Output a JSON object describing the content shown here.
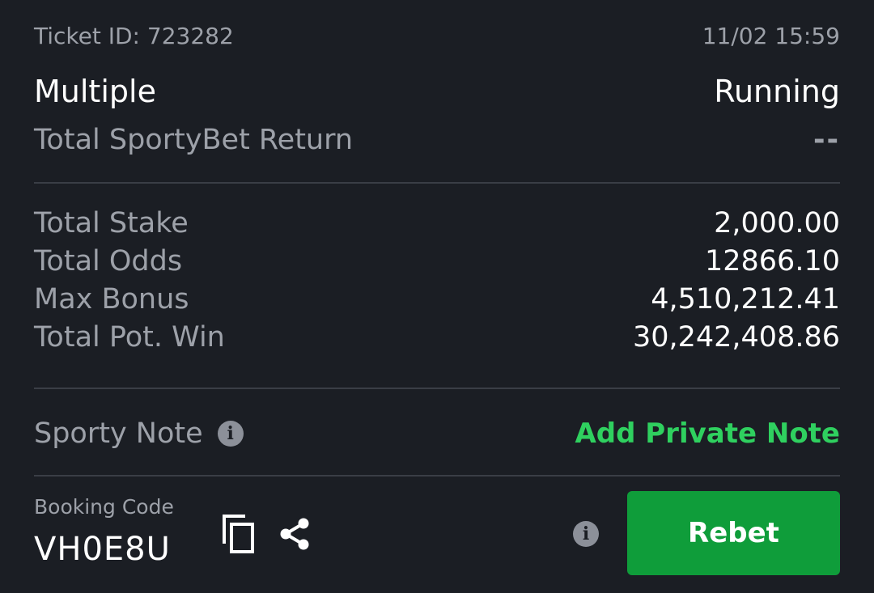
{
  "header": {
    "ticket_id": "Ticket ID: 723282",
    "datetime": "11/02 15:59"
  },
  "bet": {
    "type": "Multiple",
    "status": "Running",
    "return_label": "Total SportyBet Return",
    "return_value": "--"
  },
  "stats": [
    {
      "label": "Total Stake",
      "value": "2,000.00"
    },
    {
      "label": "Total Odds",
      "value": "12866.10"
    },
    {
      "label": "Max Bonus",
      "value": "4,510,212.41"
    },
    {
      "label": "Total Pot. Win",
      "value": "30,242,408.86"
    }
  ],
  "note": {
    "label": "Sporty Note",
    "action": "Add Private Note"
  },
  "booking": {
    "label": "Booking Code",
    "code": "VH0E8U"
  },
  "actions": {
    "rebet_label": "Rebet"
  },
  "colors": {
    "background": "#1b1e24",
    "accent_green": "#2fd05f",
    "button_green": "#0f9d3a",
    "muted_text": "#9da1a9"
  },
  "icons": [
    "info-icon",
    "copy-icon",
    "share-icon"
  ]
}
